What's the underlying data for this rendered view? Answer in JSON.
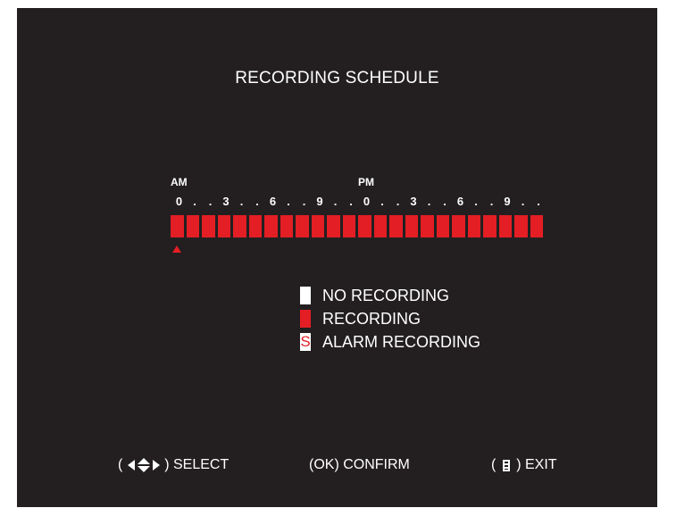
{
  "title": "RECORDING SCHEDULE",
  "timeline": {
    "am_label": "AM",
    "pm_label": "PM",
    "ticks": [
      "0",
      ".",
      ".",
      "3",
      ".",
      ".",
      "6",
      ".",
      ".",
      "9",
      ".",
      ".",
      "0",
      ".",
      ".",
      "3",
      ".",
      ".",
      "6",
      ".",
      ".",
      "9",
      ".",
      "."
    ],
    "hour_count": 24,
    "hour_states": [
      "recording",
      "recording",
      "recording",
      "recording",
      "recording",
      "recording",
      "recording",
      "recording",
      "recording",
      "recording",
      "recording",
      "recording",
      "recording",
      "recording",
      "recording",
      "recording",
      "recording",
      "recording",
      "recording",
      "recording",
      "recording",
      "recording",
      "recording",
      "recording"
    ],
    "selected_hour": 0
  },
  "legend": {
    "no_recording": "NO RECORDING",
    "recording": "RECORDING",
    "alarm_symbol": "S",
    "alarm_recording": "ALARM RECORDING"
  },
  "footer": {
    "open_paren": "( ",
    "close_paren": " )",
    "select_label": " SELECT",
    "confirm_key": "(OK)",
    "confirm_label": " CONFIRM",
    "exit_label": " EXIT"
  },
  "colors": {
    "background": "#231f20",
    "recording": "#e31e24",
    "no_recording": "#ffffff"
  },
  "icons": {
    "select_keys": [
      "arrow-left-icon",
      "arrow-up-icon",
      "arrow-down-icon",
      "arrow-right-icon"
    ],
    "exit_key": "menu-icon"
  }
}
